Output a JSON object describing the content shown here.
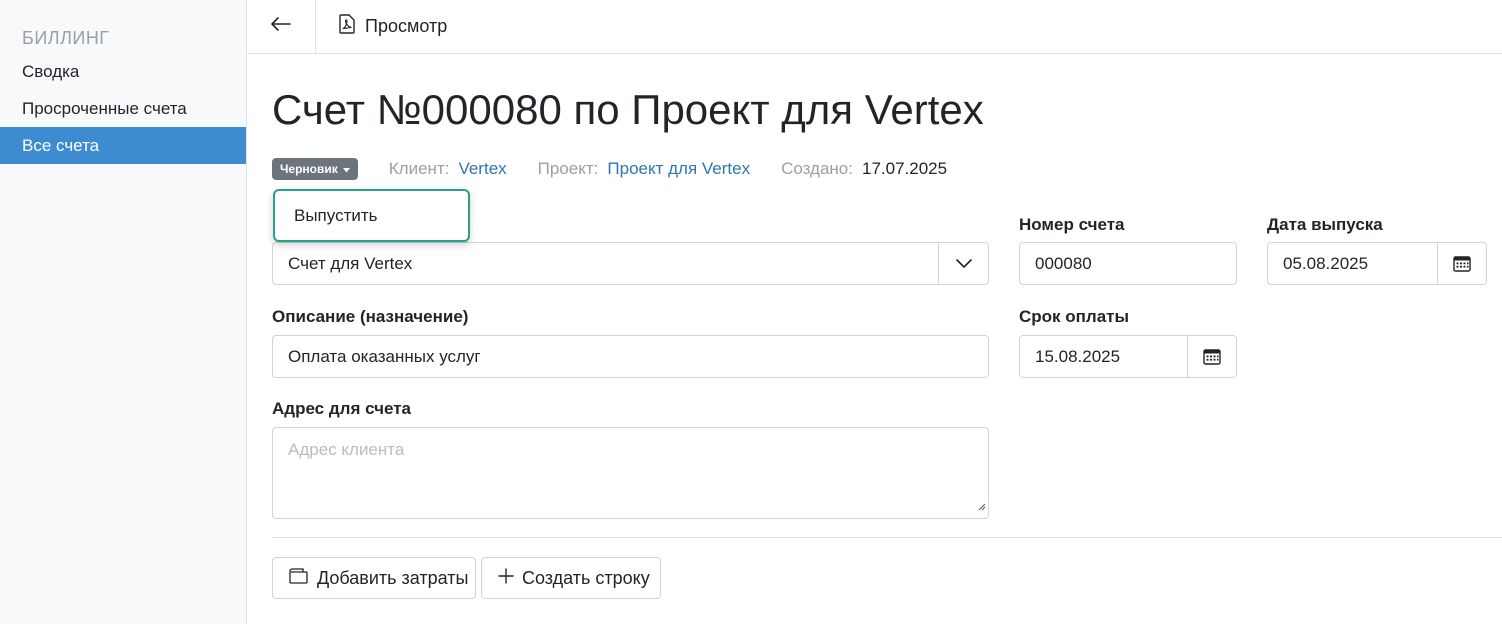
{
  "sidebar": {
    "heading": "БИЛЛИНГ",
    "items": [
      {
        "label": "Сводка",
        "active": false
      },
      {
        "label": "Просроченные счета",
        "active": false
      },
      {
        "label": "Все счета",
        "active": true
      }
    ]
  },
  "topbar": {
    "back_icon": "arrow-left-icon",
    "preview_icon": "pdf-file-icon",
    "preview_label": "Просмотр"
  },
  "invoice": {
    "title": "Счет №000080 по Проект для Vertex",
    "status": "Черновик",
    "client_label": "Клиент:",
    "client_value": "Vertex",
    "project_label": "Проект:",
    "project_value": "Проект для Vertex",
    "created_label": "Создано:",
    "created_value": "17.07.2025"
  },
  "status_menu": {
    "items": [
      "Выпустить"
    ]
  },
  "form": {
    "template_value": "Счет для Vertex",
    "number_label": "Номер счета",
    "number_value": "000080",
    "issue_date_label": "Дата выпуска",
    "issue_date_value": "05.08.2025",
    "description_label": "Описание (назначение)",
    "description_value": "Оплата оказанных услуг",
    "due_date_label": "Срок оплаты",
    "due_date_value": "15.08.2025",
    "address_label": "Адрес для счета",
    "address_placeholder": "Адрес клиента"
  },
  "actions": {
    "add_expenses_label": "Добавить затраты",
    "add_expenses_icon": "wallet-icon",
    "create_line_label": "Создать строку",
    "create_line_icon": "plus-icon"
  },
  "colors": {
    "accent": "#3d8bd0",
    "link": "#2f76b5",
    "badge": "#6c757d",
    "menu_border": "#2aa089"
  }
}
